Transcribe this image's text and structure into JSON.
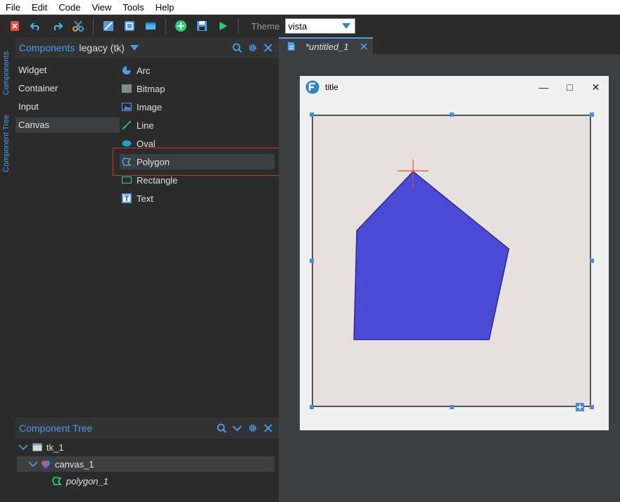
{
  "menu": [
    "File",
    "Edit",
    "Code",
    "View",
    "Tools",
    "Help"
  ],
  "toolbar": {
    "theme_label": "Theme",
    "theme_value": "vista",
    "buttons": [
      "close-icon",
      "undo-icon",
      "redo-icon",
      "cut-icon",
      "window-icon",
      "preview-icon",
      "layout-icon",
      "add-icon",
      "save-icon",
      "run-icon"
    ]
  },
  "side_tabs": [
    "Components",
    "Component Tree"
  ],
  "components_panel": {
    "title": "Components",
    "set": "legacy (tk)",
    "categories": [
      "Widget",
      "Container",
      "Input",
      "Canvas"
    ],
    "active_category": "Canvas",
    "items": [
      "Arc",
      "Bitmap",
      "Image",
      "Line",
      "Oval",
      "Polygon",
      "Rectangle",
      "Text"
    ],
    "highlighted": "Polygon"
  },
  "tree_panel": {
    "title": "Component Tree",
    "nodes": [
      {
        "label": "tk_1"
      },
      {
        "label": "canvas_1"
      },
      {
        "label": "polygon_1"
      }
    ]
  },
  "editor": {
    "tab_label": "*untitled_1",
    "window_title": "title",
    "canvas_bg": "#e8e0df",
    "polygon_fill": "#4a4ad6"
  }
}
